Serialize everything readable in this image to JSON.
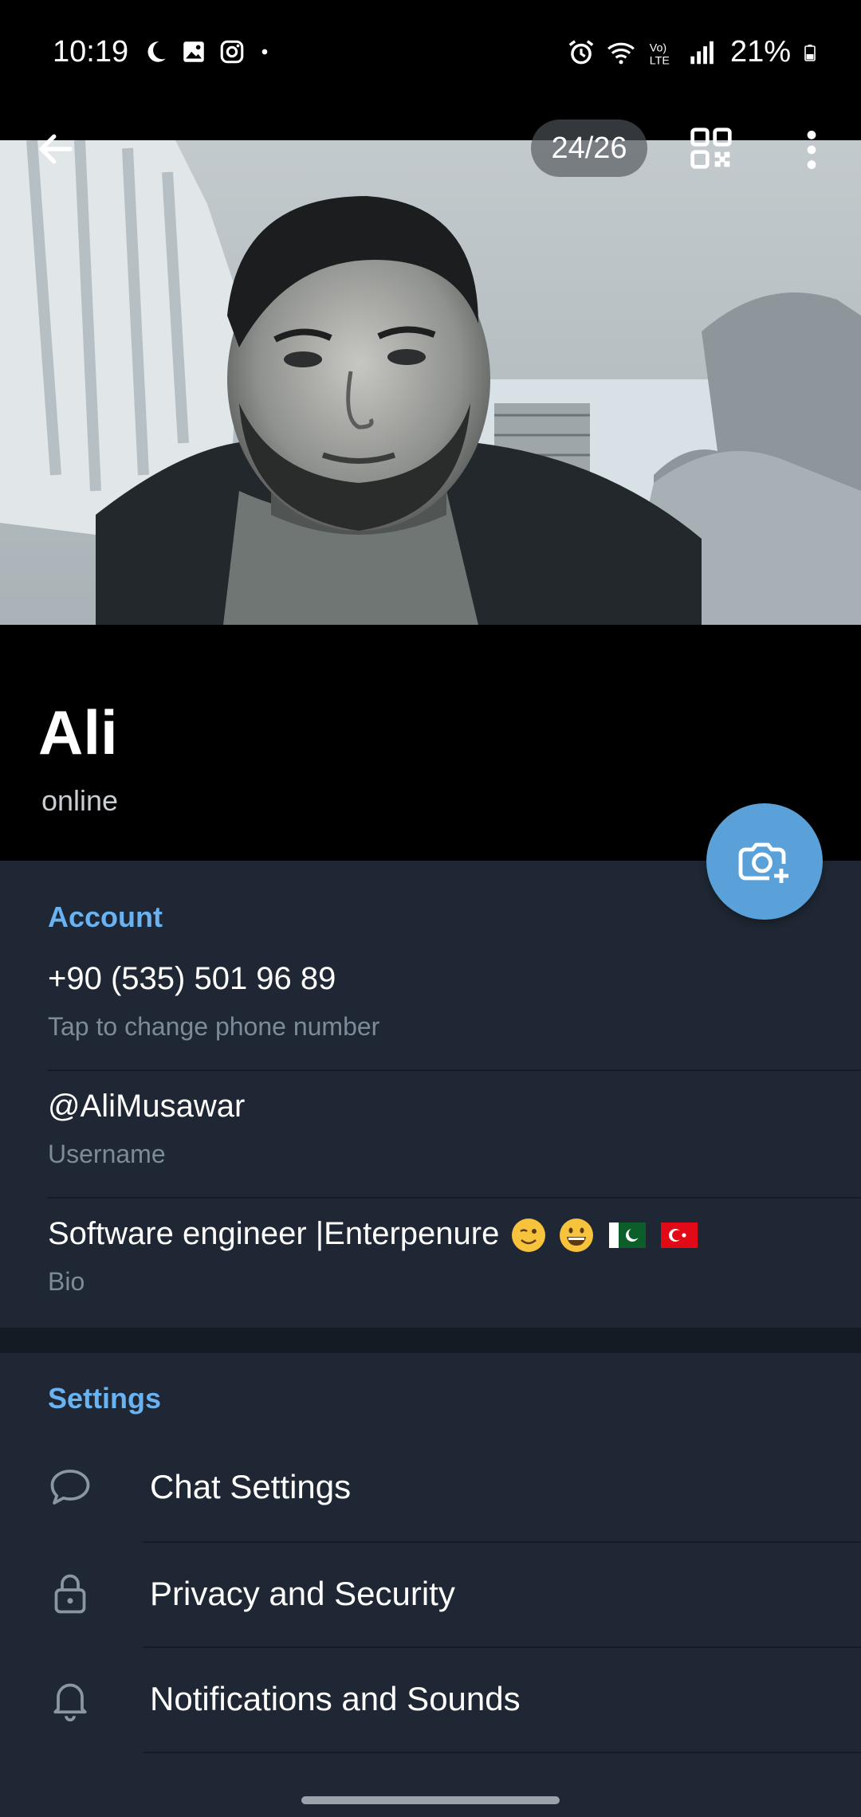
{
  "status_bar": {
    "time": "10:19",
    "battery": "21%",
    "left_icons": [
      "moon-icon",
      "gallery-icon",
      "instagram-icon",
      "dot-icon"
    ],
    "right_icons": [
      "alarm-icon",
      "wifi-icon",
      "volte-icon",
      "signal-icon",
      "battery-icon"
    ]
  },
  "header": {
    "photo_counter": "24/26"
  },
  "profile": {
    "name": "Ali",
    "status": "online"
  },
  "account": {
    "title": "Account",
    "phone": "+90 (535) 501 96 89",
    "phone_hint": "Tap to change phone number",
    "username": "@AliMusawar",
    "username_hint": "Username",
    "bio": "Software engineer |Enterpenure",
    "bio_hint": "Bio"
  },
  "settings": {
    "title": "Settings",
    "items": [
      {
        "label": "Chat Settings",
        "icon": "chat-bubble-icon"
      },
      {
        "label": "Privacy and Security",
        "icon": "lock-icon"
      },
      {
        "label": "Notifications and Sounds",
        "icon": "bell-icon"
      }
    ]
  },
  "colors": {
    "accent": "#6ab3f3",
    "fab": "#5aa1d9",
    "background": "#1e2733",
    "header_bg": "#000000"
  }
}
